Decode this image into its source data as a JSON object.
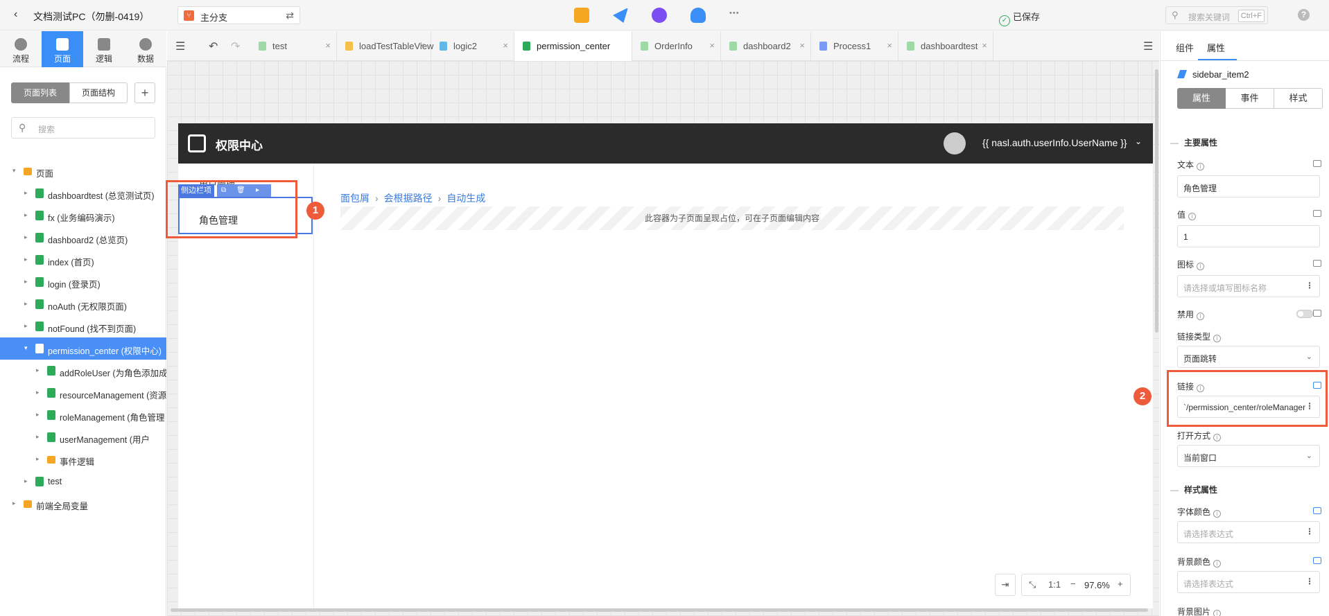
{
  "topbar": {
    "back_glyph": "‹",
    "project_title": "文档测试PC（勿删-0419）",
    "branch_label": "主分支",
    "branch_swap_glyph": "⇄",
    "tools": [
      {
        "name": "preview-icon",
        "color": "#f5a623"
      },
      {
        "name": "publish-icon",
        "color": "#3a8ef6"
      },
      {
        "name": "debug-icon",
        "color": "#7b4df2"
      },
      {
        "name": "cloud-icon",
        "color": "#3a8ef6"
      }
    ],
    "more_glyph": "•••",
    "saved_label": "已保存",
    "search_placeholder": "搜索关键词",
    "search_shortcut": "Ctrl+F",
    "help_glyph": "?"
  },
  "leftnav": {
    "tabs": [
      {
        "label": "流程"
      },
      {
        "label": "页面",
        "active": true
      },
      {
        "label": "逻辑"
      },
      {
        "label": "数据"
      }
    ]
  },
  "leftpanel": {
    "seg_page_list": "页面列表",
    "seg_page_structure": "页面结构",
    "add_glyph": "+",
    "search_placeholder": "搜索",
    "tree": [
      {
        "label": "页面",
        "type": "folder",
        "level": 0,
        "expanded": true
      },
      {
        "label": "dashboardtest (总览测试页)",
        "type": "page",
        "level": 1
      },
      {
        "label": "fx (业务编码演示)",
        "type": "page",
        "level": 1
      },
      {
        "label": "dashboard2 (总览页)",
        "type": "page",
        "level": 1
      },
      {
        "label": "index (首页)",
        "type": "page",
        "level": 1
      },
      {
        "label": "login (登录页)",
        "type": "page",
        "level": 1
      },
      {
        "label": "noAuth (无权限页面)",
        "type": "page",
        "level": 1
      },
      {
        "label": "notFound (找不到页面)",
        "type": "page",
        "level": 1
      },
      {
        "label": "permission_center (权限中心)",
        "type": "page",
        "level": 1,
        "selected": true,
        "expanded": true
      },
      {
        "label": "addRoleUser (为角色添加成",
        "type": "page",
        "level": 2
      },
      {
        "label": "resourceManagement (资源",
        "type": "page",
        "level": 2
      },
      {
        "label": "roleManagement (角色管理",
        "type": "page",
        "level": 2
      },
      {
        "label": "userManagement (用户",
        "type": "page",
        "level": 2
      },
      {
        "label": "事件逻辑",
        "type": "folder",
        "level": 2
      },
      {
        "label": "test",
        "type": "page",
        "level": 1
      },
      {
        "label": "前端全局变量",
        "type": "folder",
        "level": 0
      }
    ]
  },
  "tabbar": {
    "collapse_glyph": "☰",
    "undo_glyph": "↶",
    "redo_glyph": "↷",
    "expand_glyph": "☰",
    "tabs": [
      {
        "label": "test",
        "color": "#9fd9a8"
      },
      {
        "label": "loadTestTableView",
        "color": "#f5c04a"
      },
      {
        "label": "logic2",
        "color": "#5fb8e8"
      },
      {
        "label": "permission_center",
        "color": "#2eaa5b",
        "active": true
      },
      {
        "label": "OrderInfo",
        "color": "#9fd9a8"
      },
      {
        "label": "dashboard2",
        "color": "#9fd9a8"
      },
      {
        "label": "Process1",
        "color": "#7b9af5"
      },
      {
        "label": "dashboardtest",
        "color": "#9fd9a8"
      }
    ],
    "close_glyph": "×"
  },
  "canvas": {
    "app_title": "权限中心",
    "user_name": "{{ nasl.auth.userInfo.UserName }}",
    "user_caret": "⌄",
    "sidebar_item1": "用户管理",
    "sidebar_item2": "角色管理",
    "selection_tag": "侧边栏项",
    "breadcrumb": [
      "面包屑",
      "会根据路径",
      "自动生成"
    ],
    "breadcrumb_sep": "›",
    "placeholder_text": "此容器为子页面呈现占位，可在子页面编辑内容",
    "badge1": "1",
    "zoom": {
      "fit_glyph": "⇥",
      "shrink_glyph": "⤡",
      "ratio_label": "1:1",
      "minus_glyph": "−",
      "value": "97.6%",
      "plus_glyph": "+"
    }
  },
  "rightpanel": {
    "tab_components": "组件",
    "tab_properties": "属性",
    "component_name": "sidebar_item2",
    "seg_props": "属性",
    "seg_events": "事件",
    "seg_styles": "样式",
    "section_main": "主要属性",
    "section_style": "样式属性",
    "section_caret": "—",
    "fields": {
      "text_label": "文本",
      "text_value": "角色管理",
      "value_label": "值",
      "value_value": "1",
      "icon_label": "图标",
      "icon_placeholder": "请选择或填写图标名称",
      "disabled_label": "禁用",
      "link_type_label": "链接类型",
      "link_type_value": "页面跳转",
      "link_label": "链接",
      "link_value": "`/permission_center/roleManagement`",
      "open_mode_label": "打开方式",
      "open_mode_value": "当前窗口",
      "font_color_label": "字体颜色",
      "font_color_placeholder": "请选择表达式",
      "bg_color_label": "背景颜色",
      "bg_color_placeholder": "请选择表达式",
      "bg_image_label": "背景图片"
    },
    "badge2": "2",
    "info_glyph": "i",
    "dots_glyph": "⋮",
    "chev_glyph": "⌄"
  },
  "colors": {
    "accent": "#3a8ef6",
    "highlight": "#ee5b3b",
    "selection": "#4a78e0"
  }
}
